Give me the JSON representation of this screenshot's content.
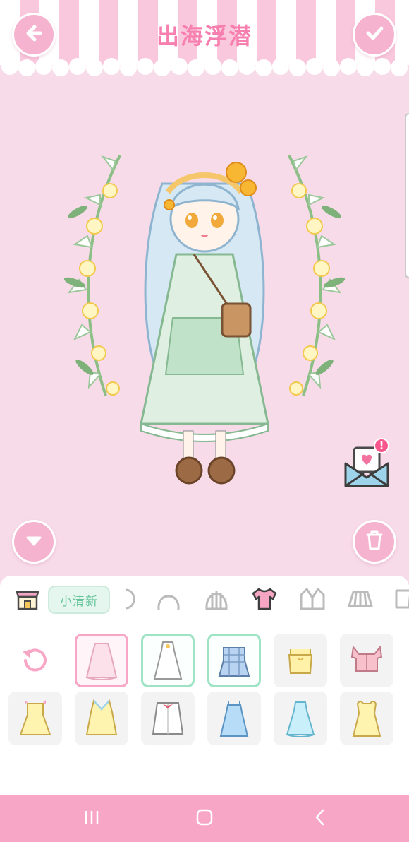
{
  "header": {
    "title": "出海浮潜",
    "back_icon": "back-arrow-icon",
    "confirm_icon": "checkmark-icon"
  },
  "canvas": {
    "character": "chibi-girl-lily-wreath",
    "mail_icon": "heart-envelope-icon",
    "mail_badge": "!"
  },
  "side_buttons": {
    "collapse_icon": "chevron-down-icon",
    "trash_icon": "trash-icon"
  },
  "category_bar": {
    "shop_icon": "shop-icon",
    "style_tag": "小清新",
    "items": [
      "face-icon",
      "hair-front-icon",
      "hair-back-icon",
      "top-icon",
      "jacket-icon",
      "skirt-icon",
      "socks-icon"
    ],
    "selected": "top-icon"
  },
  "wardrobe": {
    "reset_icon": "reset-icon",
    "items": [
      {
        "name": "pink-lace-dress",
        "state": "equipped-pink"
      },
      {
        "name": "white-dress",
        "state": "equipped-green"
      },
      {
        "name": "blue-plaid-top",
        "state": "equipped-green"
      },
      {
        "name": "yellow-camisole",
        "state": "normal"
      },
      {
        "name": "pink-ruffle-top",
        "state": "normal"
      },
      {
        "name": "yellow-bow-dress",
        "state": "normal"
      },
      {
        "name": "yellow-v-dress",
        "state": "normal"
      },
      {
        "name": "white-bow-shirt",
        "state": "normal"
      },
      {
        "name": "blue-slip-dress",
        "state": "normal"
      },
      {
        "name": "aqua-dress",
        "state": "normal"
      },
      {
        "name": "yellow-puff-dress",
        "state": "normal"
      }
    ]
  },
  "colors": {
    "background": "#f7dbe9",
    "accent_pink": "#f7a6c6",
    "title_pink": "#f77fb0",
    "accent_green": "#9ee3c4"
  },
  "system_nav": [
    "recent-apps-icon",
    "home-icon",
    "back-icon"
  ]
}
